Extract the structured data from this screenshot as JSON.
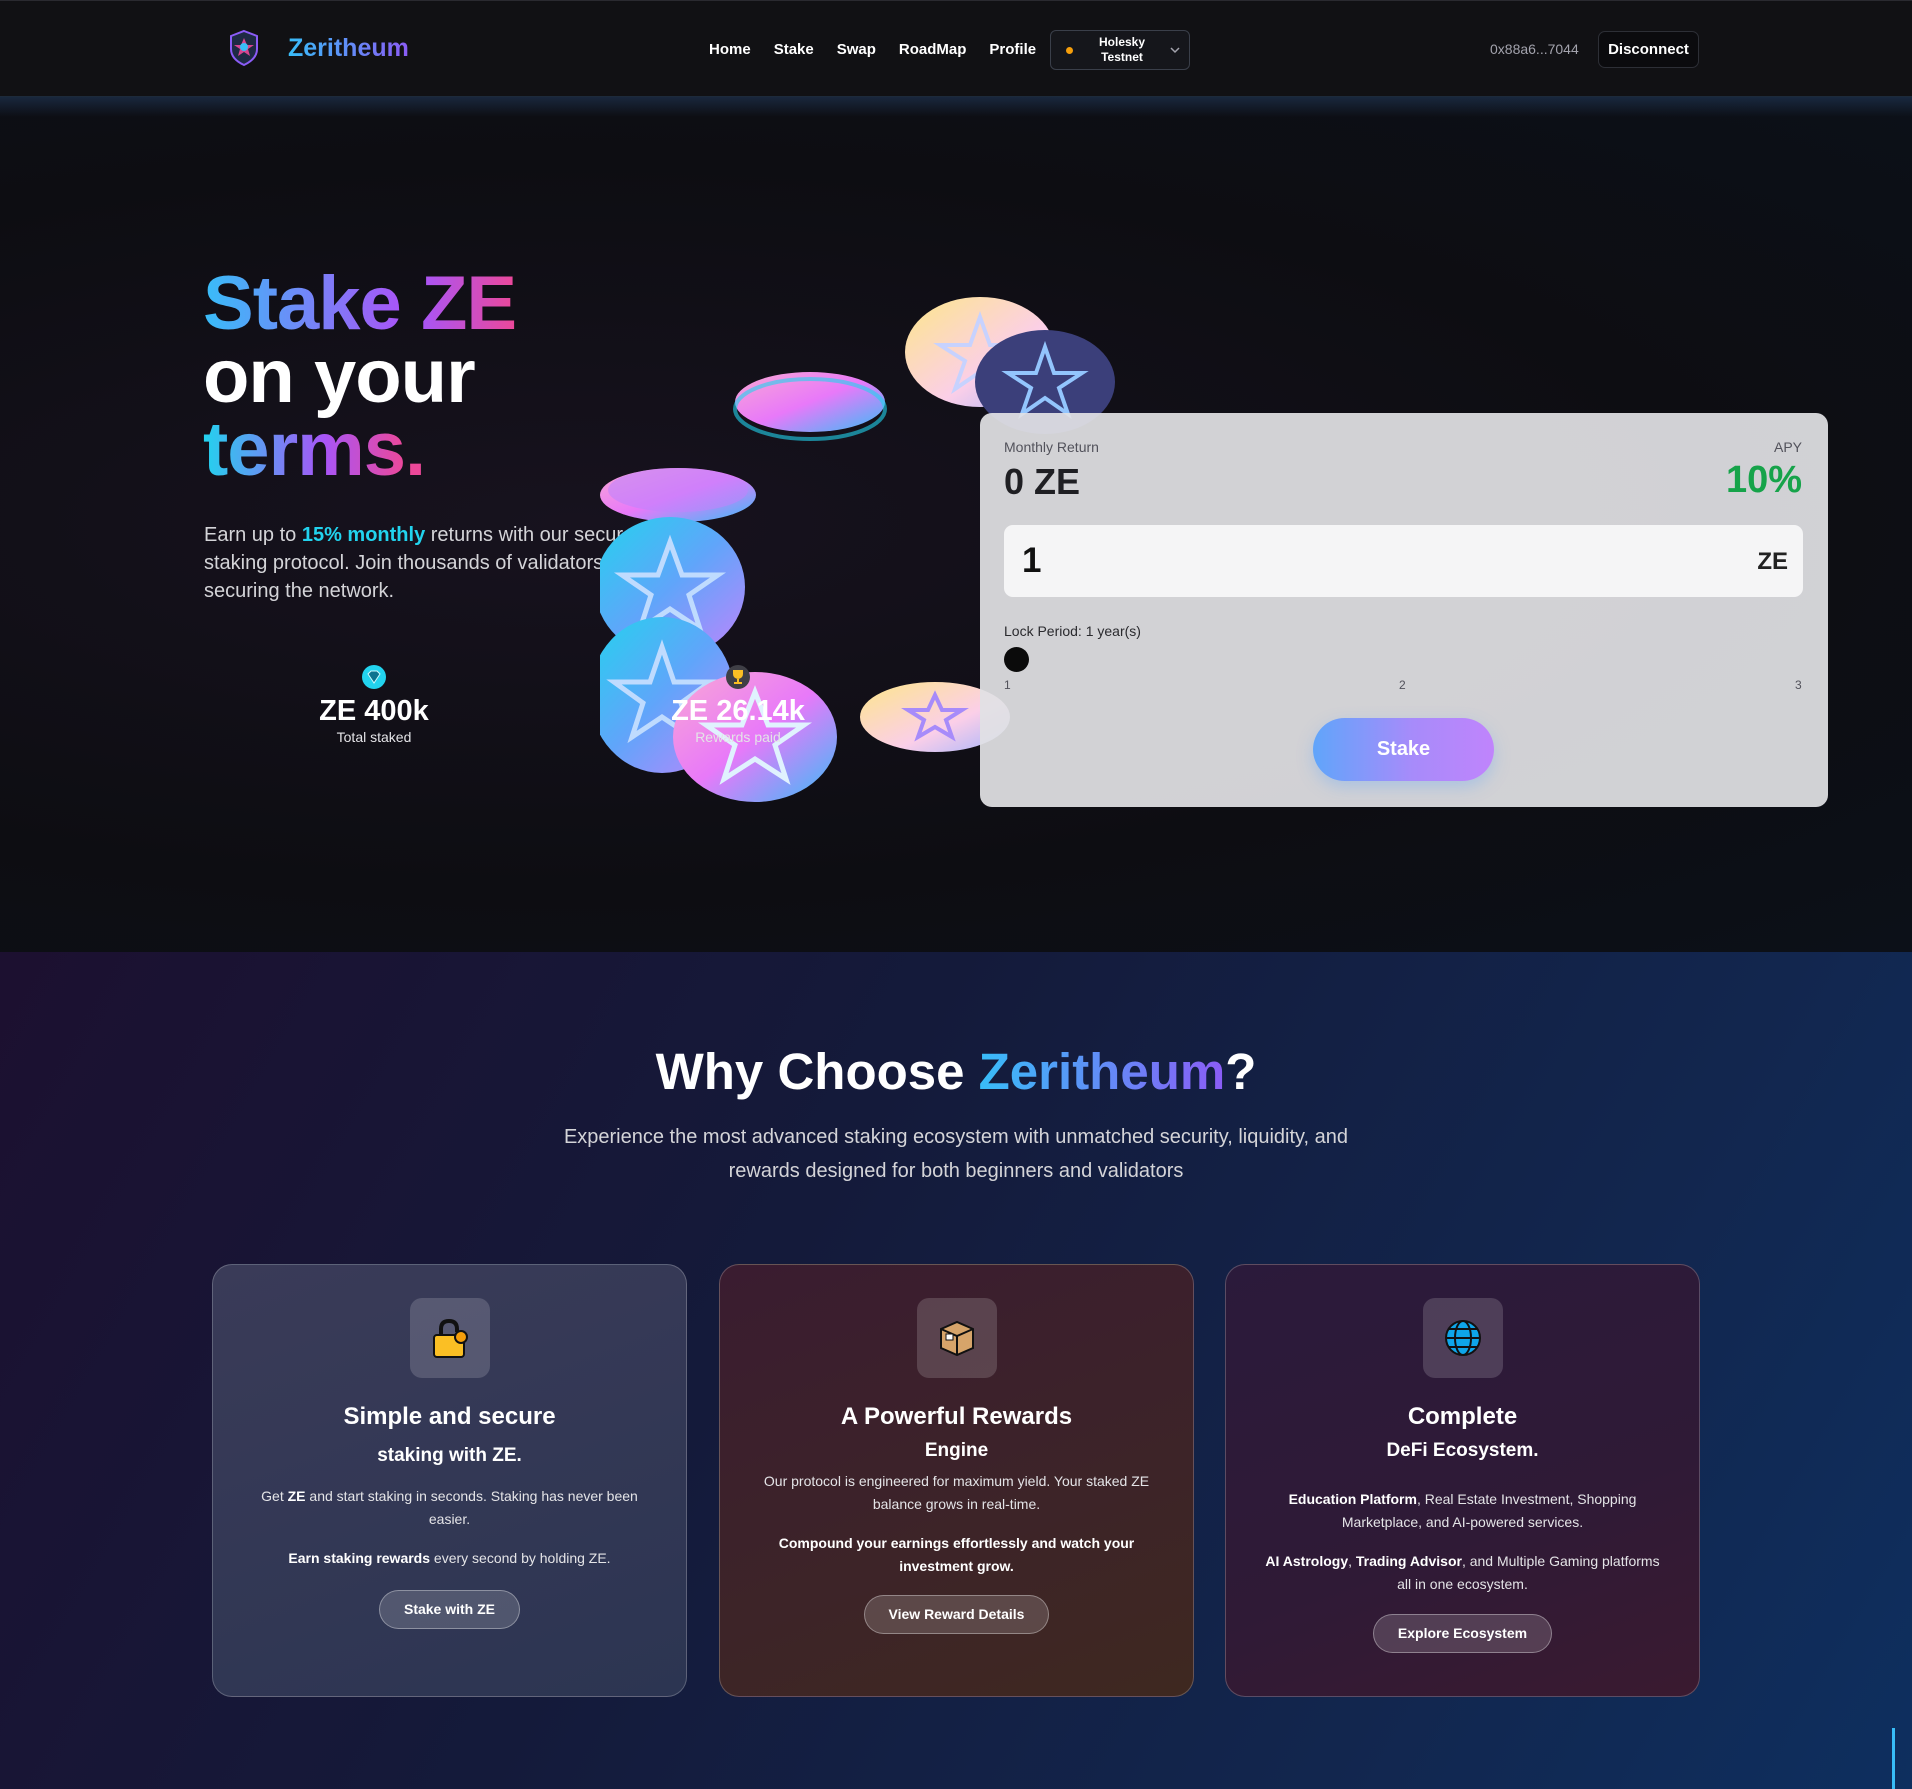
{
  "header": {
    "brand": "Zeritheum",
    "nav": [
      "Home",
      "Stake",
      "Swap",
      "RoadMap",
      "Profile"
    ],
    "network": "Holesky Testnet",
    "wallet_address": "0x88a6...7044",
    "disconnect_label": "Disconnect"
  },
  "hero": {
    "title_stake": "Stake",
    "title_ze": "ZE",
    "title_line2": "on your",
    "title_line3": "terms",
    "title_dot": ".",
    "desc_prefix": "Earn up to ",
    "desc_highlight": "15% monthly",
    "desc_suffix": " returns with our secure staking protocol. Join thousands of validators securing the network.",
    "stats": [
      {
        "icon": "diamond-icon",
        "value": "ZE 400k",
        "label": "Total staked"
      },
      {
        "icon": "trophy-icon",
        "value": "ZE 26.14k",
        "label": "Rewards paid"
      }
    ]
  },
  "stake_card": {
    "monthly_return_label": "Monthly Return",
    "monthly_return_value": "0 ZE",
    "apy_label": "APY",
    "apy_value": "10%",
    "amount_value": "1",
    "amount_unit": "ZE",
    "lock_period_label": "Lock Period: 1 year(s)",
    "lock_period_value": 1,
    "lock_ticks": [
      "1",
      "2",
      "3"
    ],
    "stake_button": "Stake"
  },
  "why": {
    "title_prefix": "Why Choose ",
    "title_accent": "Zeritheum",
    "title_suffix": "?",
    "subtitle": "Experience the most advanced staking ecosystem with unmatched security, liquidity, and rewards designed for both beginners and validators",
    "cards": [
      {
        "icon": "lock-icon",
        "title": "Simple and secure",
        "subtitle": "staking with ZE.",
        "p1_pre": "Get ",
        "p1_bold": "ZE",
        "p1_post": " and start staking in seconds. Staking has never been easier.",
        "p2_bold": "Earn staking rewards",
        "p2_post": " every second by holding ZE.",
        "button": "Stake with ZE"
      },
      {
        "icon": "box-icon",
        "title": "A Powerful Rewards",
        "subtitle": "Engine",
        "p1": "Our protocol is engineered for maximum yield. Your staked ZE balance grows in real-time.",
        "p2_bold": "Compound your earnings effortlessly and watch your investment grow.",
        "button": "View Reward Details"
      },
      {
        "icon": "globe-icon",
        "title": "Complete",
        "subtitle": "DeFi Ecosystem.",
        "p1_bold": "Education Platform",
        "p1_post": ", Real Estate Investment, Shopping Marketplace, and AI-powered services.",
        "p2_bold1": "AI Astrology",
        "p2_sep1": ", ",
        "p2_bold2": "Trading Advisor",
        "p2_post": ", and Multiple Gaming platforms all in one ecosystem.",
        "button": "Explore Ecosystem"
      }
    ]
  },
  "colors": {
    "accent_cyan": "#22d3ee",
    "accent_purple": "#a855f7",
    "accent_pink": "#ec4899",
    "apy_green": "#16a34a",
    "network_status": "#f59e0b"
  }
}
